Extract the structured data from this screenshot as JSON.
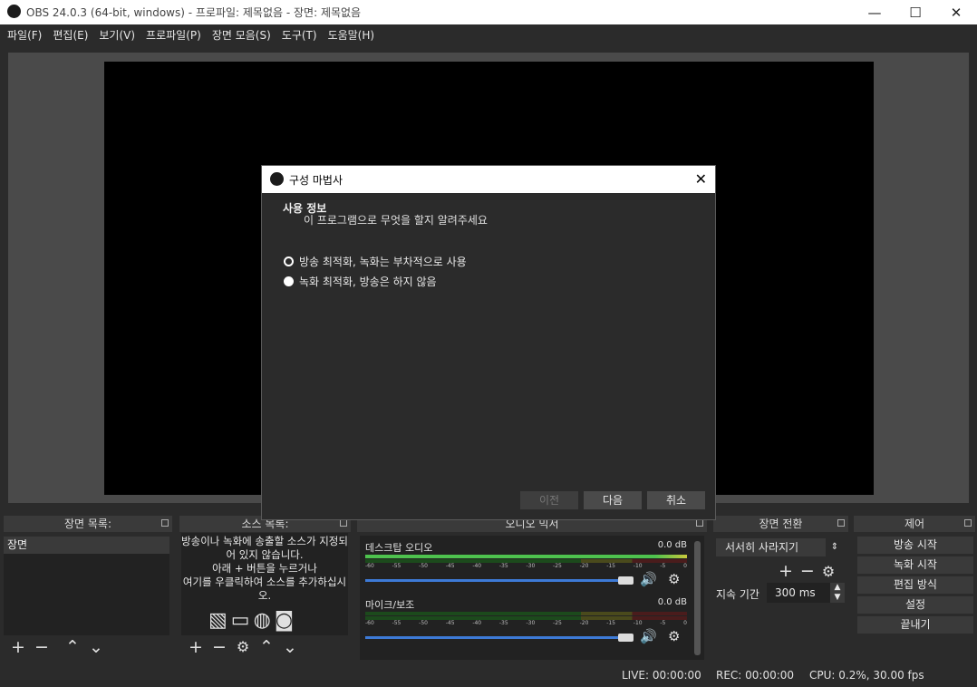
{
  "window": {
    "title": "OBS 24.0.3 (64-bit, windows) - 프로파일: 제목없음 - 장면: 제목없음",
    "minimize_glyph": "—",
    "maximize_glyph": "☐",
    "close_glyph": "✕"
  },
  "menu": [
    "파일(F)",
    "편집(E)",
    "보기(V)",
    "프로파일(P)",
    "장면 모음(S)",
    "도구(T)",
    "도움말(H)"
  ],
  "docks": {
    "scenes": {
      "title": "장면 목록:",
      "items": [
        "장면"
      ]
    },
    "sources": {
      "title": "소스 목록:",
      "empty_text": "방송이나 녹화에 송출할 소스가 지정되어 있지 않습니다.\n아래 + 버튼을 누르거나\n여기를 우클릭하여 소스를 추가하십시오."
    },
    "mixer": {
      "title": "오디오 믹서",
      "tracks": [
        {
          "name": "데스크탑 오디오",
          "db": "0.0 dB",
          "level": 1.0
        },
        {
          "name": "마이크/보조",
          "db": "0.0 dB",
          "level": 1.0
        }
      ],
      "scale": [
        "-60",
        "-55",
        "-50",
        "-45",
        "-40",
        "-35",
        "-30",
        "-25",
        "-20",
        "-15",
        "-10",
        "-5",
        "0"
      ]
    },
    "transitions": {
      "title": "장면 전환",
      "selected": "서서히 사라지기",
      "duration_label": "지속 기간",
      "duration_value": "300 ms"
    },
    "controls": {
      "title": "제어",
      "buttons": [
        "방송 시작",
        "녹화 시작",
        "편집 방식",
        "설정",
        "끝내기"
      ]
    }
  },
  "status": {
    "live": "LIVE: 00:00:00",
    "rec": "REC: 00:00:00",
    "cpu": "CPU: 0.2%, 30.00 fps"
  },
  "dialog": {
    "title": "구성 마법사",
    "heading": "사용 정보",
    "subheading": "이 프로그램으로 무엇을 할지 알려주세요",
    "options": [
      {
        "label": "방송 최적화, 녹화는 부차적으로 사용",
        "selected": false
      },
      {
        "label": "녹화 최적화, 방송은 하지 않음",
        "selected": true
      }
    ],
    "buttons": {
      "back": "이전",
      "next": "다음",
      "cancel": "취소"
    }
  },
  "colors": {
    "background": "#2b2b2b",
    "preview": "#000000",
    "accent": "#3d7ad6"
  }
}
